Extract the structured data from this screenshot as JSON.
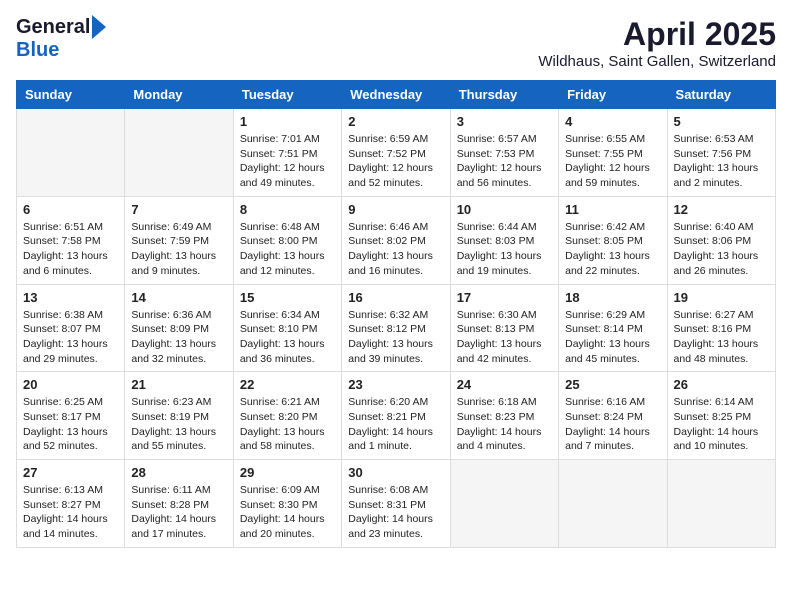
{
  "header": {
    "logo_general": "General",
    "logo_blue": "Blue",
    "month_title": "April 2025",
    "location": "Wildhaus, Saint Gallen, Switzerland"
  },
  "days_of_week": [
    "Sunday",
    "Monday",
    "Tuesday",
    "Wednesday",
    "Thursday",
    "Friday",
    "Saturday"
  ],
  "weeks": [
    [
      {
        "day": "",
        "sunrise": "",
        "sunset": "",
        "daylight": "",
        "empty": true
      },
      {
        "day": "",
        "sunrise": "",
        "sunset": "",
        "daylight": "",
        "empty": true
      },
      {
        "day": "1",
        "sunrise": "Sunrise: 7:01 AM",
        "sunset": "Sunset: 7:51 PM",
        "daylight": "Daylight: 12 hours and 49 minutes.",
        "empty": false
      },
      {
        "day": "2",
        "sunrise": "Sunrise: 6:59 AM",
        "sunset": "Sunset: 7:52 PM",
        "daylight": "Daylight: 12 hours and 52 minutes.",
        "empty": false
      },
      {
        "day": "3",
        "sunrise": "Sunrise: 6:57 AM",
        "sunset": "Sunset: 7:53 PM",
        "daylight": "Daylight: 12 hours and 56 minutes.",
        "empty": false
      },
      {
        "day": "4",
        "sunrise": "Sunrise: 6:55 AM",
        "sunset": "Sunset: 7:55 PM",
        "daylight": "Daylight: 12 hours and 59 minutes.",
        "empty": false
      },
      {
        "day": "5",
        "sunrise": "Sunrise: 6:53 AM",
        "sunset": "Sunset: 7:56 PM",
        "daylight": "Daylight: 13 hours and 2 minutes.",
        "empty": false
      }
    ],
    [
      {
        "day": "6",
        "sunrise": "Sunrise: 6:51 AM",
        "sunset": "Sunset: 7:58 PM",
        "daylight": "Daylight: 13 hours and 6 minutes.",
        "empty": false
      },
      {
        "day": "7",
        "sunrise": "Sunrise: 6:49 AM",
        "sunset": "Sunset: 7:59 PM",
        "daylight": "Daylight: 13 hours and 9 minutes.",
        "empty": false
      },
      {
        "day": "8",
        "sunrise": "Sunrise: 6:48 AM",
        "sunset": "Sunset: 8:00 PM",
        "daylight": "Daylight: 13 hours and 12 minutes.",
        "empty": false
      },
      {
        "day": "9",
        "sunrise": "Sunrise: 6:46 AM",
        "sunset": "Sunset: 8:02 PM",
        "daylight": "Daylight: 13 hours and 16 minutes.",
        "empty": false
      },
      {
        "day": "10",
        "sunrise": "Sunrise: 6:44 AM",
        "sunset": "Sunset: 8:03 PM",
        "daylight": "Daylight: 13 hours and 19 minutes.",
        "empty": false
      },
      {
        "day": "11",
        "sunrise": "Sunrise: 6:42 AM",
        "sunset": "Sunset: 8:05 PM",
        "daylight": "Daylight: 13 hours and 22 minutes.",
        "empty": false
      },
      {
        "day": "12",
        "sunrise": "Sunrise: 6:40 AM",
        "sunset": "Sunset: 8:06 PM",
        "daylight": "Daylight: 13 hours and 26 minutes.",
        "empty": false
      }
    ],
    [
      {
        "day": "13",
        "sunrise": "Sunrise: 6:38 AM",
        "sunset": "Sunset: 8:07 PM",
        "daylight": "Daylight: 13 hours and 29 minutes.",
        "empty": false
      },
      {
        "day": "14",
        "sunrise": "Sunrise: 6:36 AM",
        "sunset": "Sunset: 8:09 PM",
        "daylight": "Daylight: 13 hours and 32 minutes.",
        "empty": false
      },
      {
        "day": "15",
        "sunrise": "Sunrise: 6:34 AM",
        "sunset": "Sunset: 8:10 PM",
        "daylight": "Daylight: 13 hours and 36 minutes.",
        "empty": false
      },
      {
        "day": "16",
        "sunrise": "Sunrise: 6:32 AM",
        "sunset": "Sunset: 8:12 PM",
        "daylight": "Daylight: 13 hours and 39 minutes.",
        "empty": false
      },
      {
        "day": "17",
        "sunrise": "Sunrise: 6:30 AM",
        "sunset": "Sunset: 8:13 PM",
        "daylight": "Daylight: 13 hours and 42 minutes.",
        "empty": false
      },
      {
        "day": "18",
        "sunrise": "Sunrise: 6:29 AM",
        "sunset": "Sunset: 8:14 PM",
        "daylight": "Daylight: 13 hours and 45 minutes.",
        "empty": false
      },
      {
        "day": "19",
        "sunrise": "Sunrise: 6:27 AM",
        "sunset": "Sunset: 8:16 PM",
        "daylight": "Daylight: 13 hours and 48 minutes.",
        "empty": false
      }
    ],
    [
      {
        "day": "20",
        "sunrise": "Sunrise: 6:25 AM",
        "sunset": "Sunset: 8:17 PM",
        "daylight": "Daylight: 13 hours and 52 minutes.",
        "empty": false
      },
      {
        "day": "21",
        "sunrise": "Sunrise: 6:23 AM",
        "sunset": "Sunset: 8:19 PM",
        "daylight": "Daylight: 13 hours and 55 minutes.",
        "empty": false
      },
      {
        "day": "22",
        "sunrise": "Sunrise: 6:21 AM",
        "sunset": "Sunset: 8:20 PM",
        "daylight": "Daylight: 13 hours and 58 minutes.",
        "empty": false
      },
      {
        "day": "23",
        "sunrise": "Sunrise: 6:20 AM",
        "sunset": "Sunset: 8:21 PM",
        "daylight": "Daylight: 14 hours and 1 minute.",
        "empty": false
      },
      {
        "day": "24",
        "sunrise": "Sunrise: 6:18 AM",
        "sunset": "Sunset: 8:23 PM",
        "daylight": "Daylight: 14 hours and 4 minutes.",
        "empty": false
      },
      {
        "day": "25",
        "sunrise": "Sunrise: 6:16 AM",
        "sunset": "Sunset: 8:24 PM",
        "daylight": "Daylight: 14 hours and 7 minutes.",
        "empty": false
      },
      {
        "day": "26",
        "sunrise": "Sunrise: 6:14 AM",
        "sunset": "Sunset: 8:25 PM",
        "daylight": "Daylight: 14 hours and 10 minutes.",
        "empty": false
      }
    ],
    [
      {
        "day": "27",
        "sunrise": "Sunrise: 6:13 AM",
        "sunset": "Sunset: 8:27 PM",
        "daylight": "Daylight: 14 hours and 14 minutes.",
        "empty": false
      },
      {
        "day": "28",
        "sunrise": "Sunrise: 6:11 AM",
        "sunset": "Sunset: 8:28 PM",
        "daylight": "Daylight: 14 hours and 17 minutes.",
        "empty": false
      },
      {
        "day": "29",
        "sunrise": "Sunrise: 6:09 AM",
        "sunset": "Sunset: 8:30 PM",
        "daylight": "Daylight: 14 hours and 20 minutes.",
        "empty": false
      },
      {
        "day": "30",
        "sunrise": "Sunrise: 6:08 AM",
        "sunset": "Sunset: 8:31 PM",
        "daylight": "Daylight: 14 hours and 23 minutes.",
        "empty": false
      },
      {
        "day": "",
        "sunrise": "",
        "sunset": "",
        "daylight": "",
        "empty": true
      },
      {
        "day": "",
        "sunrise": "",
        "sunset": "",
        "daylight": "",
        "empty": true
      },
      {
        "day": "",
        "sunrise": "",
        "sunset": "",
        "daylight": "",
        "empty": true
      }
    ]
  ]
}
